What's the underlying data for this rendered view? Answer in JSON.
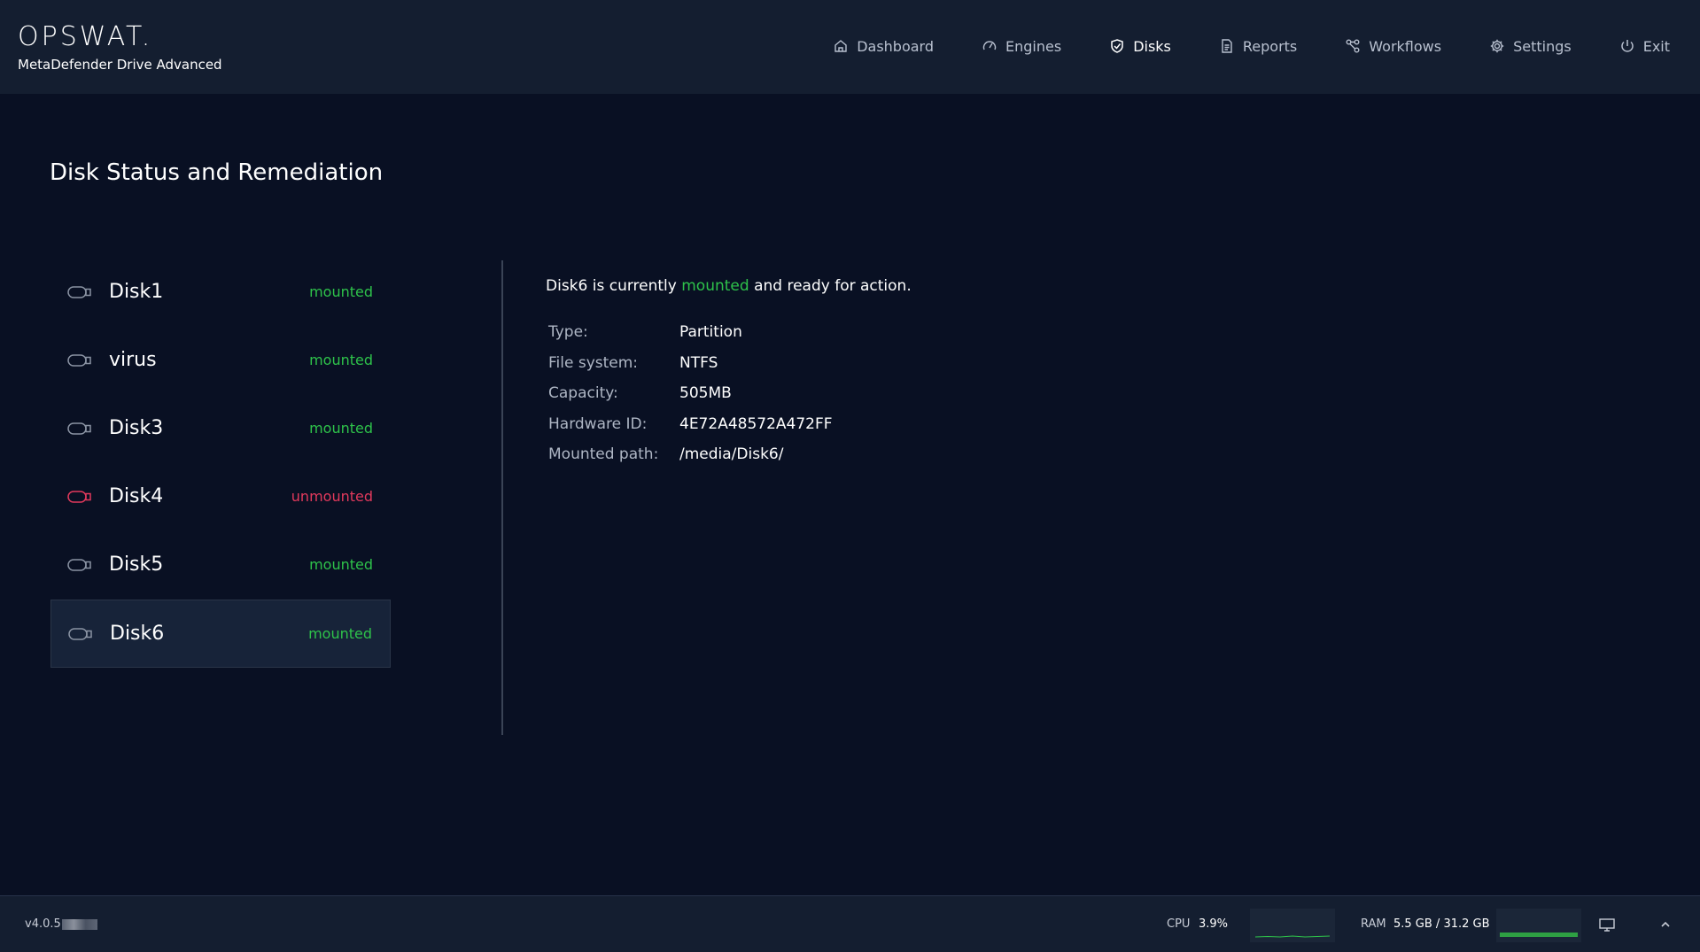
{
  "brand": {
    "logo": "OPSWAT.",
    "product": "MetaDefender Drive Advanced"
  },
  "nav": [
    {
      "label": "Dashboard",
      "icon": "home-icon"
    },
    {
      "label": "Engines",
      "icon": "gauge-icon"
    },
    {
      "label": "Disks",
      "icon": "shield-check-icon",
      "active": true
    },
    {
      "label": "Reports",
      "icon": "document-icon"
    },
    {
      "label": "Workflows",
      "icon": "workflow-icon"
    },
    {
      "label": "Settings",
      "icon": "gear-icon"
    },
    {
      "label": "Exit",
      "icon": "power-icon"
    }
  ],
  "page": {
    "title": "Disk Status and Remediation"
  },
  "disks": [
    {
      "name": "Disk1",
      "status": "mounted"
    },
    {
      "name": "virus",
      "status": "mounted"
    },
    {
      "name": "Disk3",
      "status": "mounted"
    },
    {
      "name": "Disk4",
      "status": "unmounted"
    },
    {
      "name": "Disk5",
      "status": "mounted"
    },
    {
      "name": "Disk6",
      "status": "mounted",
      "selected": true
    }
  ],
  "details": {
    "summary_prefix": "Disk6 is currently",
    "summary_status": "mounted",
    "summary_suffix": "and ready for action.",
    "props": [
      {
        "label": "Type:",
        "value": "Partition"
      },
      {
        "label": "File system:",
        "value": "NTFS"
      },
      {
        "label": "Capacity:",
        "value": "505MB"
      },
      {
        "label": "Hardware ID:",
        "value": "4E72A48572A472FF"
      },
      {
        "label": "Mounted path:",
        "value": "/media/Disk6/"
      }
    ]
  },
  "footer": {
    "version": "v4.0.5",
    "cpu_label": "CPU",
    "cpu_value": "3.9%",
    "ram_label": "RAM",
    "ram_value": "5.5 GB / 31.2 GB",
    "ram_fraction": 0.176
  },
  "colors": {
    "mounted": "#2ec24a",
    "unmounted": "#e2395c",
    "background": "#091023",
    "header": "#141e30"
  }
}
